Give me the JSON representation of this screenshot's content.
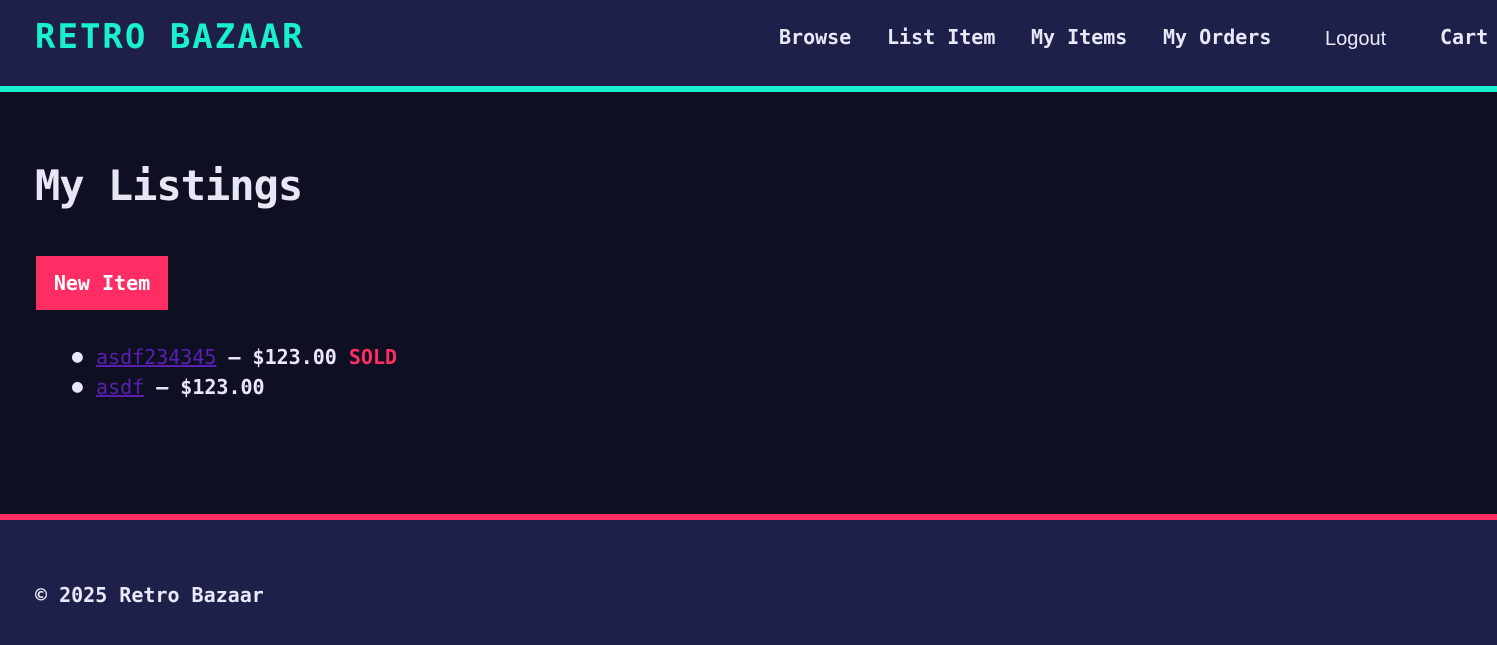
{
  "header": {
    "brand": "RETRO BAZAAR",
    "nav": {
      "browse": "Browse",
      "list_item": "List Item",
      "my_items": "My Items",
      "my_orders": "My Orders",
      "logout": "Logout",
      "cart": "Cart"
    }
  },
  "main": {
    "title": "My Listings",
    "new_item_label": "New Item",
    "listings": [
      {
        "name": "asdf234345",
        "separator": " – ",
        "price": "$123.00",
        "status": "SOLD"
      },
      {
        "name": "asdf",
        "separator": " – ",
        "price": "$123.00",
        "status": ""
      }
    ]
  },
  "footer": {
    "copyright": "© 2025 Retro Bazaar"
  },
  "colors": {
    "accent_teal": "#18f0cf",
    "accent_pink": "#ff2d63",
    "header_bg": "#1f204a",
    "page_bg": "#0e0f22",
    "link_purple": "#5a1fb0"
  }
}
